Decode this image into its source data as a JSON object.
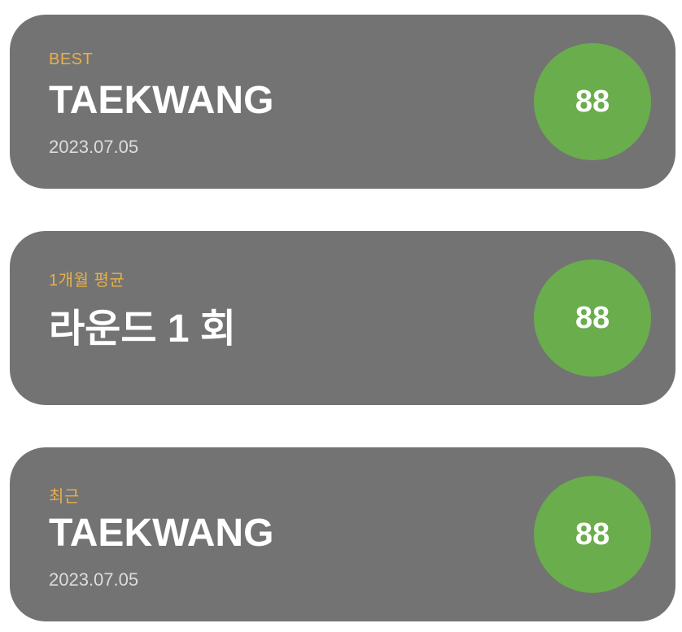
{
  "cards": [
    {
      "tag": "BEST",
      "title": "TAEKWANG",
      "date": "2023.07.05",
      "score": "88"
    },
    {
      "tag": "1개월 평균",
      "title": "라운드 1 회",
      "date": "",
      "score": "88"
    },
    {
      "tag": "최근",
      "title": "TAEKWANG",
      "date": "2023.07.05",
      "score": "88"
    }
  ],
  "colors": {
    "card_background": "#737373",
    "tag_accent": "#e7b04a",
    "score_circle": "#6aad4d",
    "text": "#ffffff"
  }
}
